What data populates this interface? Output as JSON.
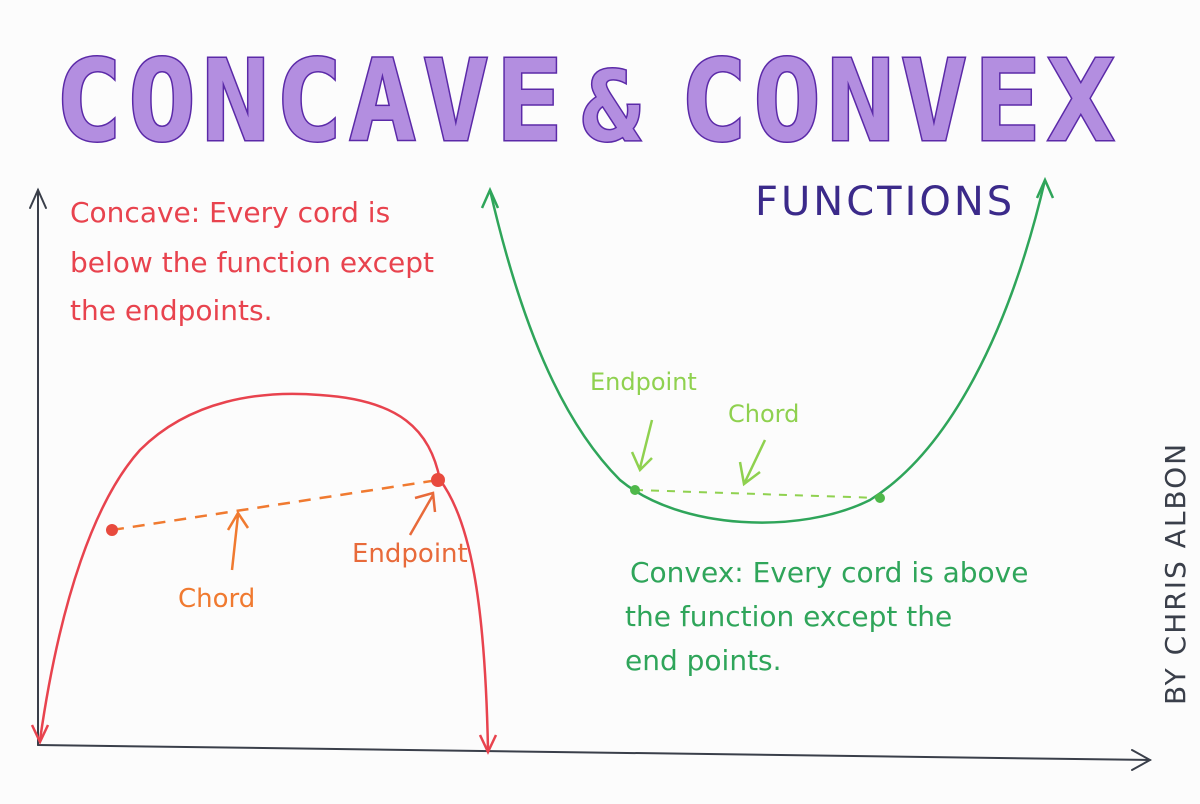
{
  "title": {
    "left_word": "CONCAVE",
    "amp": "&",
    "right_word": "CONVEX",
    "subtitle": "FUNCTIONS"
  },
  "concave": {
    "description_lines": [
      "Concave: Every cord is",
      "below the function except",
      "the endpoints."
    ],
    "chord_label": "Chord",
    "endpoint_label": "Endpoint"
  },
  "convex": {
    "description_lines": [
      "Convex: Every cord is above",
      "the function except the",
      "end points."
    ],
    "chord_label": "Chord",
    "endpoint_label": "Endpoint"
  },
  "credit": "BY CHRIS ALBON",
  "colors": {
    "title_fill": "#b38ee0",
    "title_stroke": "#5b2aa8",
    "concave_curve": "#e8434e",
    "concave_chord": "#f07a30",
    "convex_curve": "#2fa55a",
    "convex_chord": "#8fd14f",
    "axis": "#3a3f4a",
    "credit": "#3a3f4a"
  }
}
